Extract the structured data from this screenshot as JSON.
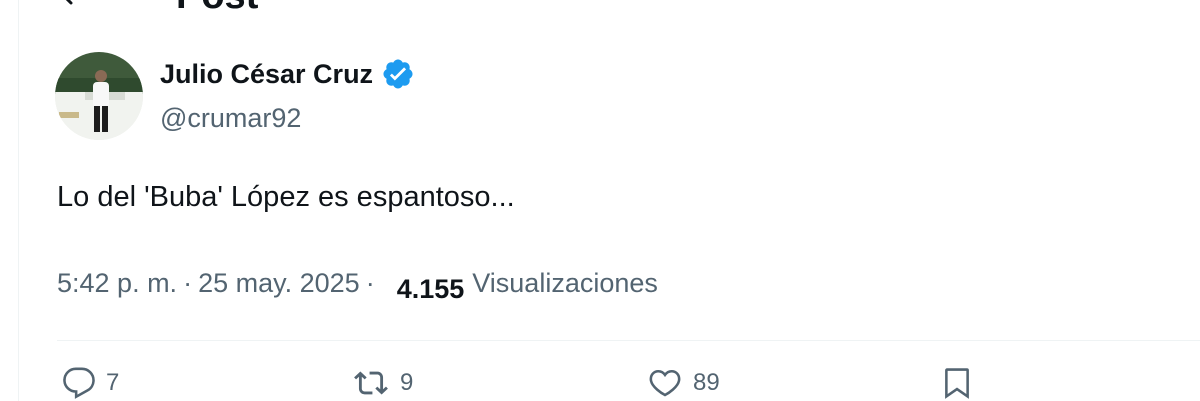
{
  "header": {
    "title": "Post",
    "back_icon": "arrow-left-icon"
  },
  "post": {
    "author_name": "Julio César Cruz",
    "author_handle": "@crumar92",
    "verified_icon": "verified-badge-icon",
    "text": "Lo del 'Buba' López es espantoso...",
    "time": "5:42 p. m.",
    "date": "25 may. 2025",
    "views_count": "4.155",
    "views_label": "Visualizaciones"
  },
  "actions": {
    "replies": "7",
    "reposts": "9",
    "likes": "89",
    "reply_icon": "reply-icon",
    "repost_icon": "repost-icon",
    "like_icon": "heart-icon",
    "bookmark_icon": "bookmark-icon"
  },
  "colors": {
    "primary_text": "#0f1419",
    "secondary_text": "#536471",
    "verified_blue": "#1d9bf0",
    "divider": "#eff3f4"
  }
}
